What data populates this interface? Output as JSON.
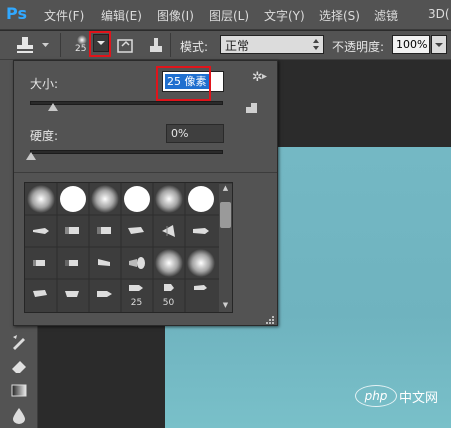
{
  "app": {
    "logo": "Ps"
  },
  "menu": [
    {
      "label": "文件(F)"
    },
    {
      "label": "编辑(E)"
    },
    {
      "label": "图像(I)"
    },
    {
      "label": "图层(L)"
    },
    {
      "label": "文字(Y)"
    },
    {
      "label": "选择(S)"
    },
    {
      "label": "滤镜"
    },
    {
      "label": "3D("
    }
  ],
  "options_bar": {
    "brush_size_preview": "25",
    "mode_label": "模式:",
    "mode_value": "正常",
    "opacity_label": "不透明度:",
    "opacity_value": "100%"
  },
  "brush_panel": {
    "size_label": "大小:",
    "size_value": "25 像素",
    "size_level": 0.1,
    "hardness_label": "硬度:",
    "hardness_value": "0%",
    "hardness_level": 0.0,
    "preset_numbers": [
      "25",
      "50"
    ]
  },
  "toolbar": {
    "icons": [
      "brush-tool-icon",
      "history-brush-icon",
      "eraser-icon",
      "gradient-icon",
      "blur-icon"
    ]
  },
  "watermark": {
    "logo": "php",
    "text": "中文网"
  },
  "colors": {
    "highlight": "#e0141b",
    "canvas": "#74b8c4",
    "selection": "#1f6fcf"
  }
}
